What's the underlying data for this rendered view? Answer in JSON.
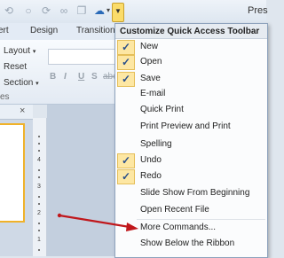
{
  "window": {
    "title": "Pres"
  },
  "ribbon_tabs": [
    "ert",
    "Design",
    "Transition"
  ],
  "ribbon": {
    "layout_label": "Layout",
    "reset_label": "Reset",
    "section_label": "Section",
    "group_suffix": "es",
    "format_buttons": [
      "B",
      "I",
      "U",
      "S",
      "abe"
    ]
  },
  "menu": {
    "title": "Customize Quick Access Toolbar",
    "items": [
      {
        "label": "New",
        "checked": true
      },
      {
        "label": "Open",
        "checked": true
      },
      {
        "label": "Save",
        "checked": true
      },
      {
        "label": "E-mail",
        "checked": false
      },
      {
        "label": "Quick Print",
        "checked": false
      },
      {
        "label": "Print Preview and Print",
        "checked": false
      },
      {
        "label": "Spelling",
        "checked": false
      },
      {
        "label": "Undo",
        "checked": true
      },
      {
        "label": "Redo",
        "checked": true
      },
      {
        "label": "Slide Show From Beginning",
        "checked": false
      },
      {
        "label": "Open Recent File",
        "checked": false
      },
      {
        "label": "More Commands...",
        "checked": false
      },
      {
        "label": "Show Below the Ribbon",
        "checked": false
      }
    ]
  },
  "panel": {
    "close_glyph": "×"
  },
  "ruler_numbers": [
    "4",
    "3",
    "2",
    "1"
  ],
  "colors": {
    "accent": "#f0b22a",
    "arrow": "#c0171b",
    "check_bg": "#fde7a3"
  }
}
